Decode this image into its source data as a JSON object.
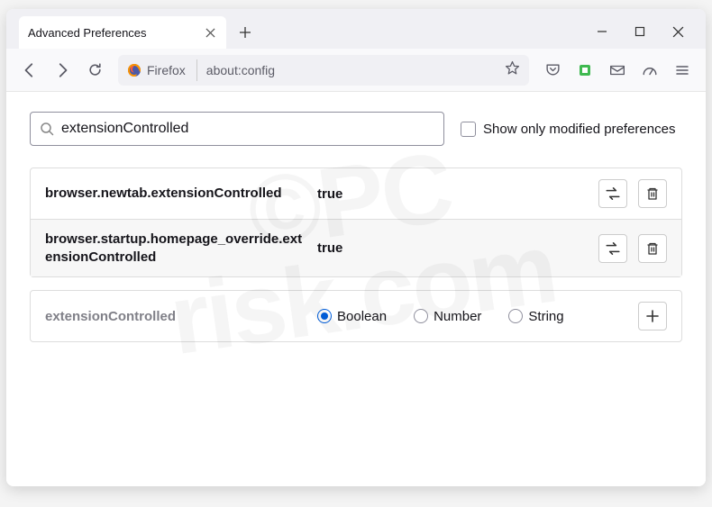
{
  "window": {
    "tab_title": "Advanced Preferences"
  },
  "toolbar": {
    "identity_label": "Firefox",
    "url": "about:config"
  },
  "search": {
    "value": "extensionControlled",
    "checkbox_label": "Show only modified preferences"
  },
  "prefs": [
    {
      "name": "browser.newtab.extensionControlled",
      "value": "true"
    },
    {
      "name": "browser.startup.homepage_override.extensionControlled",
      "value": "true"
    }
  ],
  "add": {
    "name": "extensionControlled",
    "types": [
      "Boolean",
      "Number",
      "String"
    ],
    "selected": "Boolean"
  }
}
